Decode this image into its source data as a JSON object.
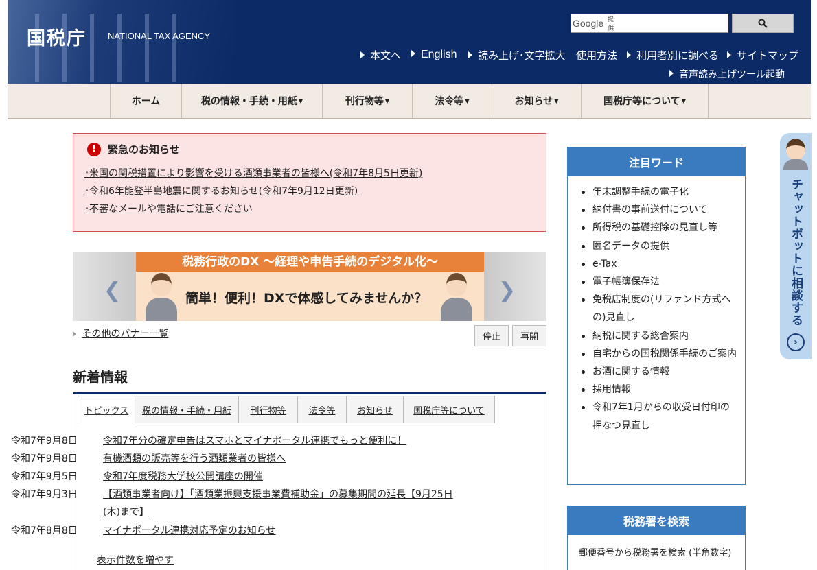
{
  "header": {
    "logo_jp": "国税庁",
    "logo_en": "NATIONAL TAX AGENCY",
    "search": {
      "brand": "Google",
      "brand_sub": "提供",
      "placeholder": ""
    },
    "utility_links": [
      "本文へ",
      "English",
      "読み上げ･文字拡大",
      "使用方法",
      "利用者別に調べる",
      "サイトマップ"
    ],
    "voice_tool": "音声読み上げツール起動"
  },
  "nav": {
    "items": [
      "ホーム",
      "税の情報・手続・用紙",
      "刊行物等",
      "法令等",
      "お知らせ",
      "国税庁等について"
    ]
  },
  "emergency": {
    "title": "緊急のお知らせ",
    "links": [
      "･米国の関税措置により影響を受ける酒類事業者の皆様へ(令和7年8月5日更新)",
      "･令和6年能登半島地震に関するお知らせ(令和7年9月12日更新)",
      "･不審なメールや電話にご注意ください"
    ]
  },
  "banner": {
    "headline": "税務行政のDX ～経理や申告手続のデジタル化～",
    "tagline": "簡単！便利！DXで体感してみませんか？",
    "list_link": "その他のバナー一覧",
    "stop": "停止",
    "resume": "再開"
  },
  "news": {
    "heading": "新着情報",
    "tabs": [
      "トピックス",
      "税の情報・手続・用紙",
      "刊行物等",
      "法令等",
      "お知らせ",
      "国税庁等について"
    ],
    "items": [
      {
        "date": "令和7年9月8日",
        "title": "令和7年分の確定申告はスマホとマイナポータル連携でもっと便利に！"
      },
      {
        "date": "令和7年9月8日",
        "title": "有機酒類の販売等を行う酒類業者の皆様へ"
      },
      {
        "date": "令和7年9月5日",
        "title": "令和7年度税務大学校公開講座の開催"
      },
      {
        "date": "令和7年9月3日",
        "title": "【酒類事業者向け】「酒類業振興支援事業費補助金」の募集期間の延長【9月25日(木)まで】"
      },
      {
        "date": "令和7年8月8日",
        "title": "マイナポータル連携対応予定のお知らせ"
      }
    ],
    "more": "表示件数を増やす"
  },
  "keywords": {
    "title": "注目ワード",
    "items": [
      "年末調整手続の電子化",
      "納付書の事前送付について",
      "所得税の基礎控除の見直し等",
      "匿名データの提供",
      "e-Tax",
      "電子帳簿保存法",
      "免税店制度の(リファンド方式への)見直し",
      "納税に関する総合案内",
      "自宅からの国税関係手続のご案内",
      "お酒に関する情報",
      "採用情報",
      "令和7年1月からの収受日付印の押なつ見直し"
    ]
  },
  "office_search": {
    "title": "税務署を検索",
    "desc": "郵便番号から税務署を検索 (半角数字)"
  },
  "chatbot": {
    "label": "チャットボットに相談する"
  },
  "colors": {
    "header_bg": "#0b2a66",
    "accent_blue": "#3a7bbf",
    "emergency_bg": "#fde4e4",
    "emergency_border": "#d05050",
    "banner_orange": "#e8823a"
  }
}
